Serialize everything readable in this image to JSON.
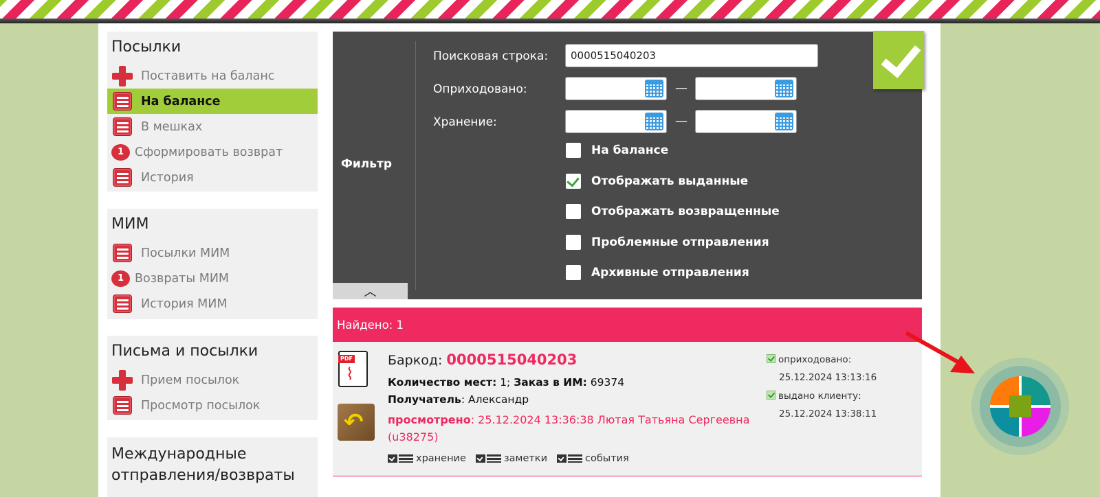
{
  "sidebar": {
    "parcels": {
      "title": "Посылки",
      "items": [
        {
          "label": "Поставить на баланс",
          "icon": "plus-icon"
        },
        {
          "label": "На балансе",
          "icon": "list-icon",
          "active": true
        },
        {
          "label": "В мешках",
          "icon": "list-icon"
        },
        {
          "label": "Сформировать возврат",
          "badge": "1"
        },
        {
          "label": "История",
          "icon": "list-icon"
        }
      ]
    },
    "mim": {
      "title": "МИМ",
      "items": [
        {
          "label": "Посылки МИМ",
          "icon": "list-icon"
        },
        {
          "label": "Возвраты МИМ",
          "badge": "1"
        },
        {
          "label": "История МИМ",
          "icon": "list-icon"
        }
      ]
    },
    "letters": {
      "title": "Письма и посылки",
      "items": [
        {
          "label": "Прием посылок",
          "icon": "plus-icon"
        },
        {
          "label": "Просмотр посылок",
          "icon": "list-icon"
        }
      ]
    },
    "intl": {
      "title_line1": "Международные",
      "title_line2": "отправления/возвраты"
    }
  },
  "filter": {
    "label": "Фильтр",
    "search_label": "Поисковая строка:",
    "search_value": "0000515040203",
    "received_label": "Оприходовано:",
    "storage_label": "Хранение:",
    "range_separator": "—",
    "checkboxes": [
      {
        "label": "На балансе",
        "checked": false
      },
      {
        "label": "Отображать выданные",
        "checked": true
      },
      {
        "label": "Отображать возвращенные",
        "checked": false
      },
      {
        "label": "Проблемные отправления",
        "checked": false
      },
      {
        "label": "Архивные отправления",
        "checked": false
      }
    ],
    "collapse_glyph": "︿"
  },
  "results": {
    "found_text": "Найдено: 1",
    "item": {
      "pdf_tag": "PDF",
      "barcode_label": "Баркод: ",
      "barcode": "0000515040203",
      "places_label": "Количество мест:",
      "places": " 1; ",
      "order_label": "Заказ в ИМ:",
      "order": " 69374",
      "recipient_label": "Получатель",
      "recipient": ": Александр",
      "viewed_label": "просмотрено",
      "viewed_text": ": 25.12.2024 13:36:38 Лютая Татьяна Сергеевна (u38275)",
      "links": [
        "хранение",
        "заметки",
        "события"
      ],
      "status": [
        {
          "label": "оприходовано:",
          "time": "25.12.2024 13:13:16"
        },
        {
          "label": "выдано клиенту:",
          "time": "25.12.2024 13:38:11"
        }
      ]
    }
  },
  "colors": {
    "accent_green": "#a2cd3a",
    "accent_pink": "#ee2a60",
    "panel_dark": "#4a4a4a"
  }
}
